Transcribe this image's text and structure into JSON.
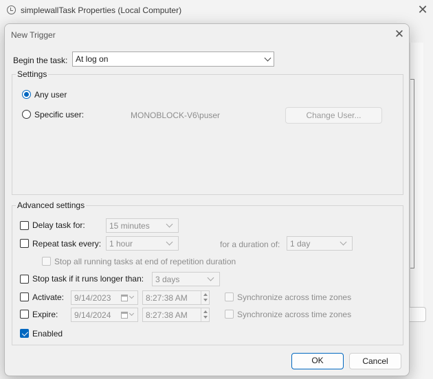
{
  "parent_window": {
    "title": "simplewallTask Properties (Local Computer)",
    "close_glyph": "✕"
  },
  "dialog": {
    "title": "New Trigger",
    "close_glyph": "✕"
  },
  "begin": {
    "label": "Begin the task:",
    "value": "At log on"
  },
  "settings": {
    "group_title": "Settings",
    "any_user_label": "Any user",
    "any_user_selected": true,
    "specific_user_label": "Specific user:",
    "specific_user_selected": false,
    "user_name": "MONOBLOCK-V6\\puser",
    "change_user_label": "Change User..."
  },
  "advanced": {
    "group_title": "Advanced settings",
    "delay_label": "Delay task for:",
    "delay_checked": false,
    "delay_value": "15 minutes",
    "repeat_label": "Repeat task every:",
    "repeat_checked": false,
    "repeat_value": "1 hour",
    "duration_label": "for a duration of:",
    "duration_value": "1 day",
    "stop_running_label": "Stop all running tasks at end of repetition duration",
    "stop_running_checked": false,
    "stop_longer_label": "Stop task if it runs longer than:",
    "stop_longer_checked": false,
    "stop_longer_value": "3 days",
    "activate_label": "Activate:",
    "activate_checked": false,
    "activate_date": "9/14/2023",
    "activate_time": "8:27:38 AM",
    "activate_sync_label": "Synchronize across time zones",
    "expire_label": "Expire:",
    "expire_checked": false,
    "expire_date": "9/14/2024",
    "expire_time": "8:27:38 AM",
    "expire_sync_label": "Synchronize across time zones",
    "enabled_label": "Enabled",
    "enabled_checked": true
  },
  "buttons": {
    "ok_label": "OK",
    "cancel_label": "Cancel"
  },
  "colors": {
    "accent": "#0067c0",
    "dialog_bg": "#f0f0f0",
    "disabled_text": "#8d8d8d"
  },
  "icons": [
    "task-scheduler-icon",
    "close-icon",
    "chevron-down-icon",
    "calendar-icon",
    "spin-up-icon",
    "spin-down-icon",
    "checkmark-icon"
  ]
}
